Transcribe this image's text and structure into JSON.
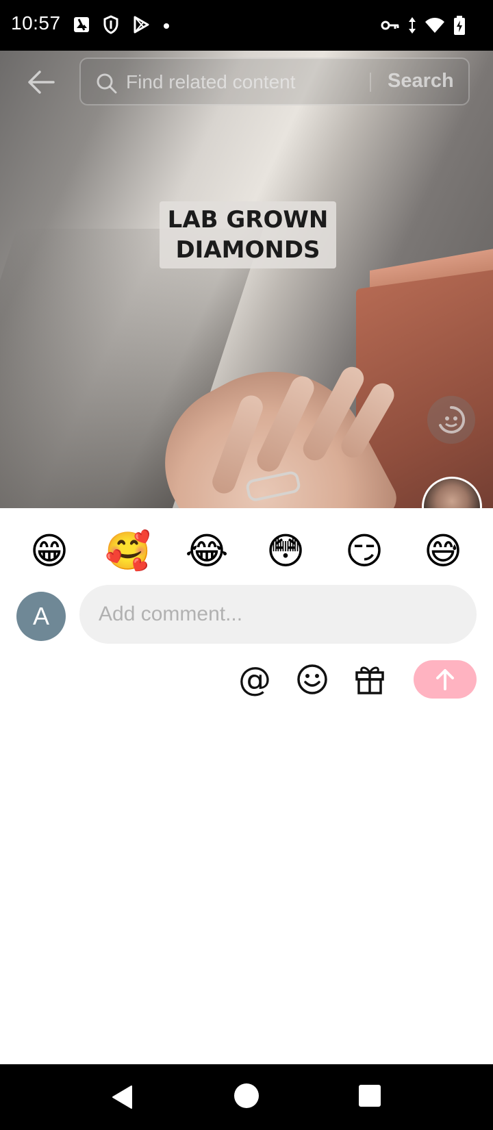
{
  "status_bar": {
    "time": "10:57",
    "left_icons": [
      "photo-sync-icon",
      "shield-icon",
      "play-store-icon",
      "notification-dot-icon"
    ],
    "right_icons": [
      "vpn-key-icon",
      "data-arrows-icon",
      "wifi-icon",
      "battery-charging-icon"
    ]
  },
  "top_bar": {
    "back_icon": "arrow-left-icon",
    "search": {
      "placeholder": "Find related content",
      "button_label": "Search"
    }
  },
  "video": {
    "caption": [
      "LAB GROWN",
      "DIAMONDS"
    ]
  },
  "comment_sheet": {
    "quick_emojis": [
      "😁",
      "🥰",
      "😂",
      "😳",
      "😏",
      "😅"
    ],
    "user_avatar_letter": "A",
    "input": {
      "placeholder": "Add comment...",
      "value": ""
    },
    "tools": {
      "mention_symbol": "@",
      "emoji_icon": "smiley-icon",
      "gift_icon": "gift-icon",
      "send_icon": "arrow-up-icon"
    },
    "colors": {
      "send_button": "#ffb3c1",
      "input_background": "#f0f0f0",
      "avatar_background": "#6f8896"
    }
  },
  "nav_bar": {
    "buttons": [
      "back-triangle-icon",
      "home-circle-icon",
      "recents-square-icon"
    ]
  }
}
